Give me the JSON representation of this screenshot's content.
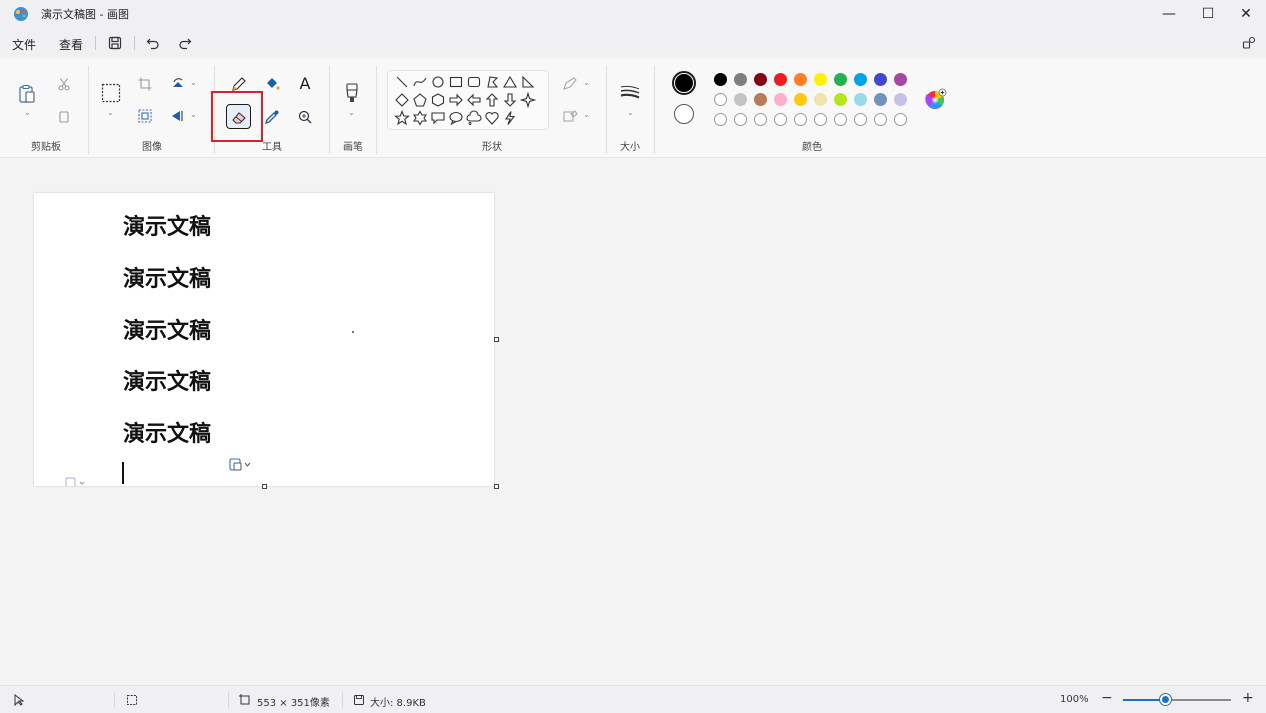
{
  "window": {
    "title": "演示文稿图 - 画图",
    "minimize": "—",
    "maximize": "☐",
    "close": "✕"
  },
  "menu": {
    "file": "文件",
    "view": "查看"
  },
  "ribbon": {
    "groups": {
      "clipboard": "剪贴板",
      "image": "图像",
      "tools": "工具",
      "brushes": "画笔",
      "shapes": "形状",
      "size": "大小",
      "colors": "颜色"
    },
    "text_tool": "A",
    "selected_tool": "eraser-icon",
    "accent_highlight": "#d4232a",
    "palette_row1": [
      "#000000",
      "#7f7f7f",
      "#880015",
      "#ed1c24",
      "#ff7f27",
      "#fff200",
      "#22b14c",
      "#00a2e8",
      "#3f48cc",
      "#a349a4"
    ],
    "palette_row2": [
      "#ffffff",
      "#c3c3c3",
      "#b97a57",
      "#ffaec9",
      "#ffc90e",
      "#efe4b0",
      "#b5e61d",
      "#99d9ea",
      "#7092be",
      "#c8bfe7"
    ],
    "primary_color": "#000000",
    "secondary_color": "#ffffff"
  },
  "canvas": {
    "lines": [
      "演示文稿",
      "演示文稿",
      "演示文稿",
      "演示文稿",
      "演示文稿"
    ]
  },
  "status": {
    "dimensions": "553 × 351像素",
    "file_size": "大小: 8.9KB",
    "zoom": "100%",
    "zoom_minus": "−",
    "zoom_plus": "+",
    "zoom_slider_fraction": 0.39
  }
}
